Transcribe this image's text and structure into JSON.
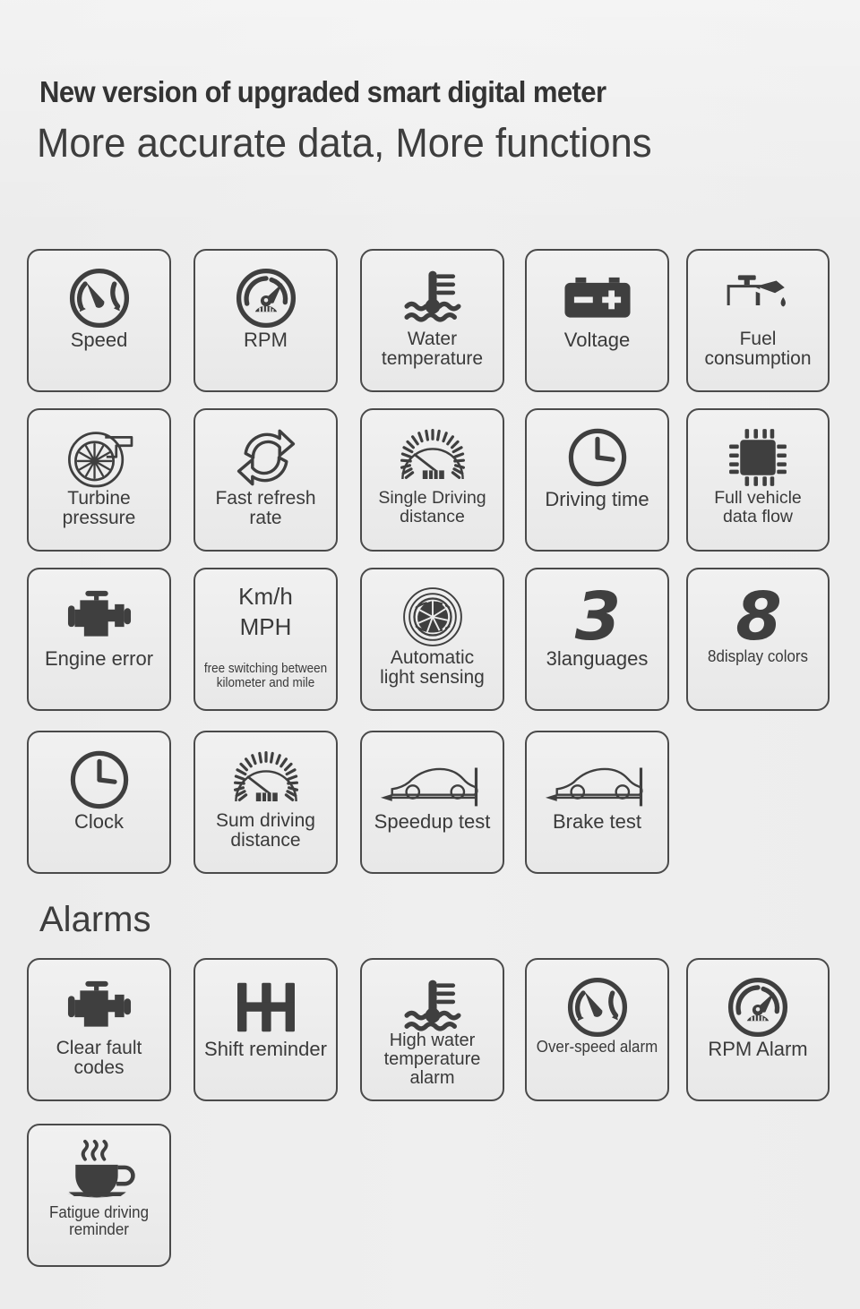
{
  "header": {
    "headline": "New version of upgraded smart digital meter",
    "subhead": "More accurate data,  More functions"
  },
  "sections": [
    {
      "id": "features",
      "title": "",
      "tiles": [
        {
          "label": "Speed",
          "icon": "speed-gauge-icon",
          "lines": 1
        },
        {
          "label": "RPM",
          "icon": "rpm-gauge-icon",
          "lines": 1
        },
        {
          "label": "Water\ntemperature",
          "icon": "water-temperature-icon",
          "lines": 2
        },
        {
          "label": "Voltage",
          "icon": "battery-voltage-icon",
          "lines": 1
        },
        {
          "label": "Fuel\nconsumption",
          "icon": "oil-can-icon",
          "lines": 2
        },
        {
          "label": "Turbine\npressure",
          "icon": "turbocharger-icon",
          "lines": 2
        },
        {
          "label": "Fast refresh\nrate",
          "icon": "refresh-arrows-icon",
          "lines": 2
        },
        {
          "label": "Single Driving\ndistance",
          "icon": "odometer-icon",
          "lines": 2
        },
        {
          "label": "Driving time",
          "icon": "clock-icon",
          "lines": 1
        },
        {
          "label": "Full vehicle\ndata flow",
          "icon": "chip-icon",
          "lines": 2
        },
        {
          "label": "Engine error",
          "icon": "engine-icon",
          "lines": 1
        },
        {
          "label": "",
          "icon": "unit-switch-text",
          "lines": 0,
          "unit_primary": "Km/h",
          "unit_secondary": "MPH",
          "caption": "free switching between\nkilometer and mile"
        },
        {
          "label": "Automatic\nlight sensing",
          "icon": "aperture-icon",
          "lines": 2
        },
        {
          "label": "3languages",
          "icon": "digit-3",
          "lines": 1,
          "digit": "3"
        },
        {
          "label": "8display colors",
          "icon": "digit-8",
          "lines": 1,
          "digit": "8"
        },
        {
          "label": "Clock",
          "icon": "clock-icon",
          "lines": 1
        },
        {
          "label": "Sum driving\ndistance",
          "icon": "odometer-icon",
          "lines": 2
        },
        {
          "label": "Speedup test",
          "icon": "car-accel-icon",
          "lines": 1
        },
        {
          "label": "Brake test",
          "icon": "car-brake-icon",
          "lines": 1
        }
      ]
    },
    {
      "id": "alarms",
      "title": "Alarms",
      "tiles": [
        {
          "label": "Clear fault\ncodes",
          "icon": "engine-icon",
          "lines": 2
        },
        {
          "label": "Shift reminder",
          "icon": "gear-shift-icon",
          "lines": 1
        },
        {
          "label": "High water\ntemperature\nalarm",
          "icon": "water-temperature-icon",
          "lines": 3
        },
        {
          "label": "Over-speed alarm",
          "icon": "speed-gauge-icon",
          "lines": 1
        },
        {
          "label": "RPM Alarm",
          "icon": "rpm-gauge-icon",
          "lines": 1
        },
        {
          "label": "Fatigue driving\nreminder",
          "icon": "coffee-cup-icon",
          "lines": 2
        }
      ]
    }
  ],
  "colors": {
    "background": "#eeeeee",
    "tile_fill": "#eeeeee",
    "tile_border": "#4a4a4a",
    "text": "#3a3a3a",
    "icon": "#3f3f3f"
  }
}
